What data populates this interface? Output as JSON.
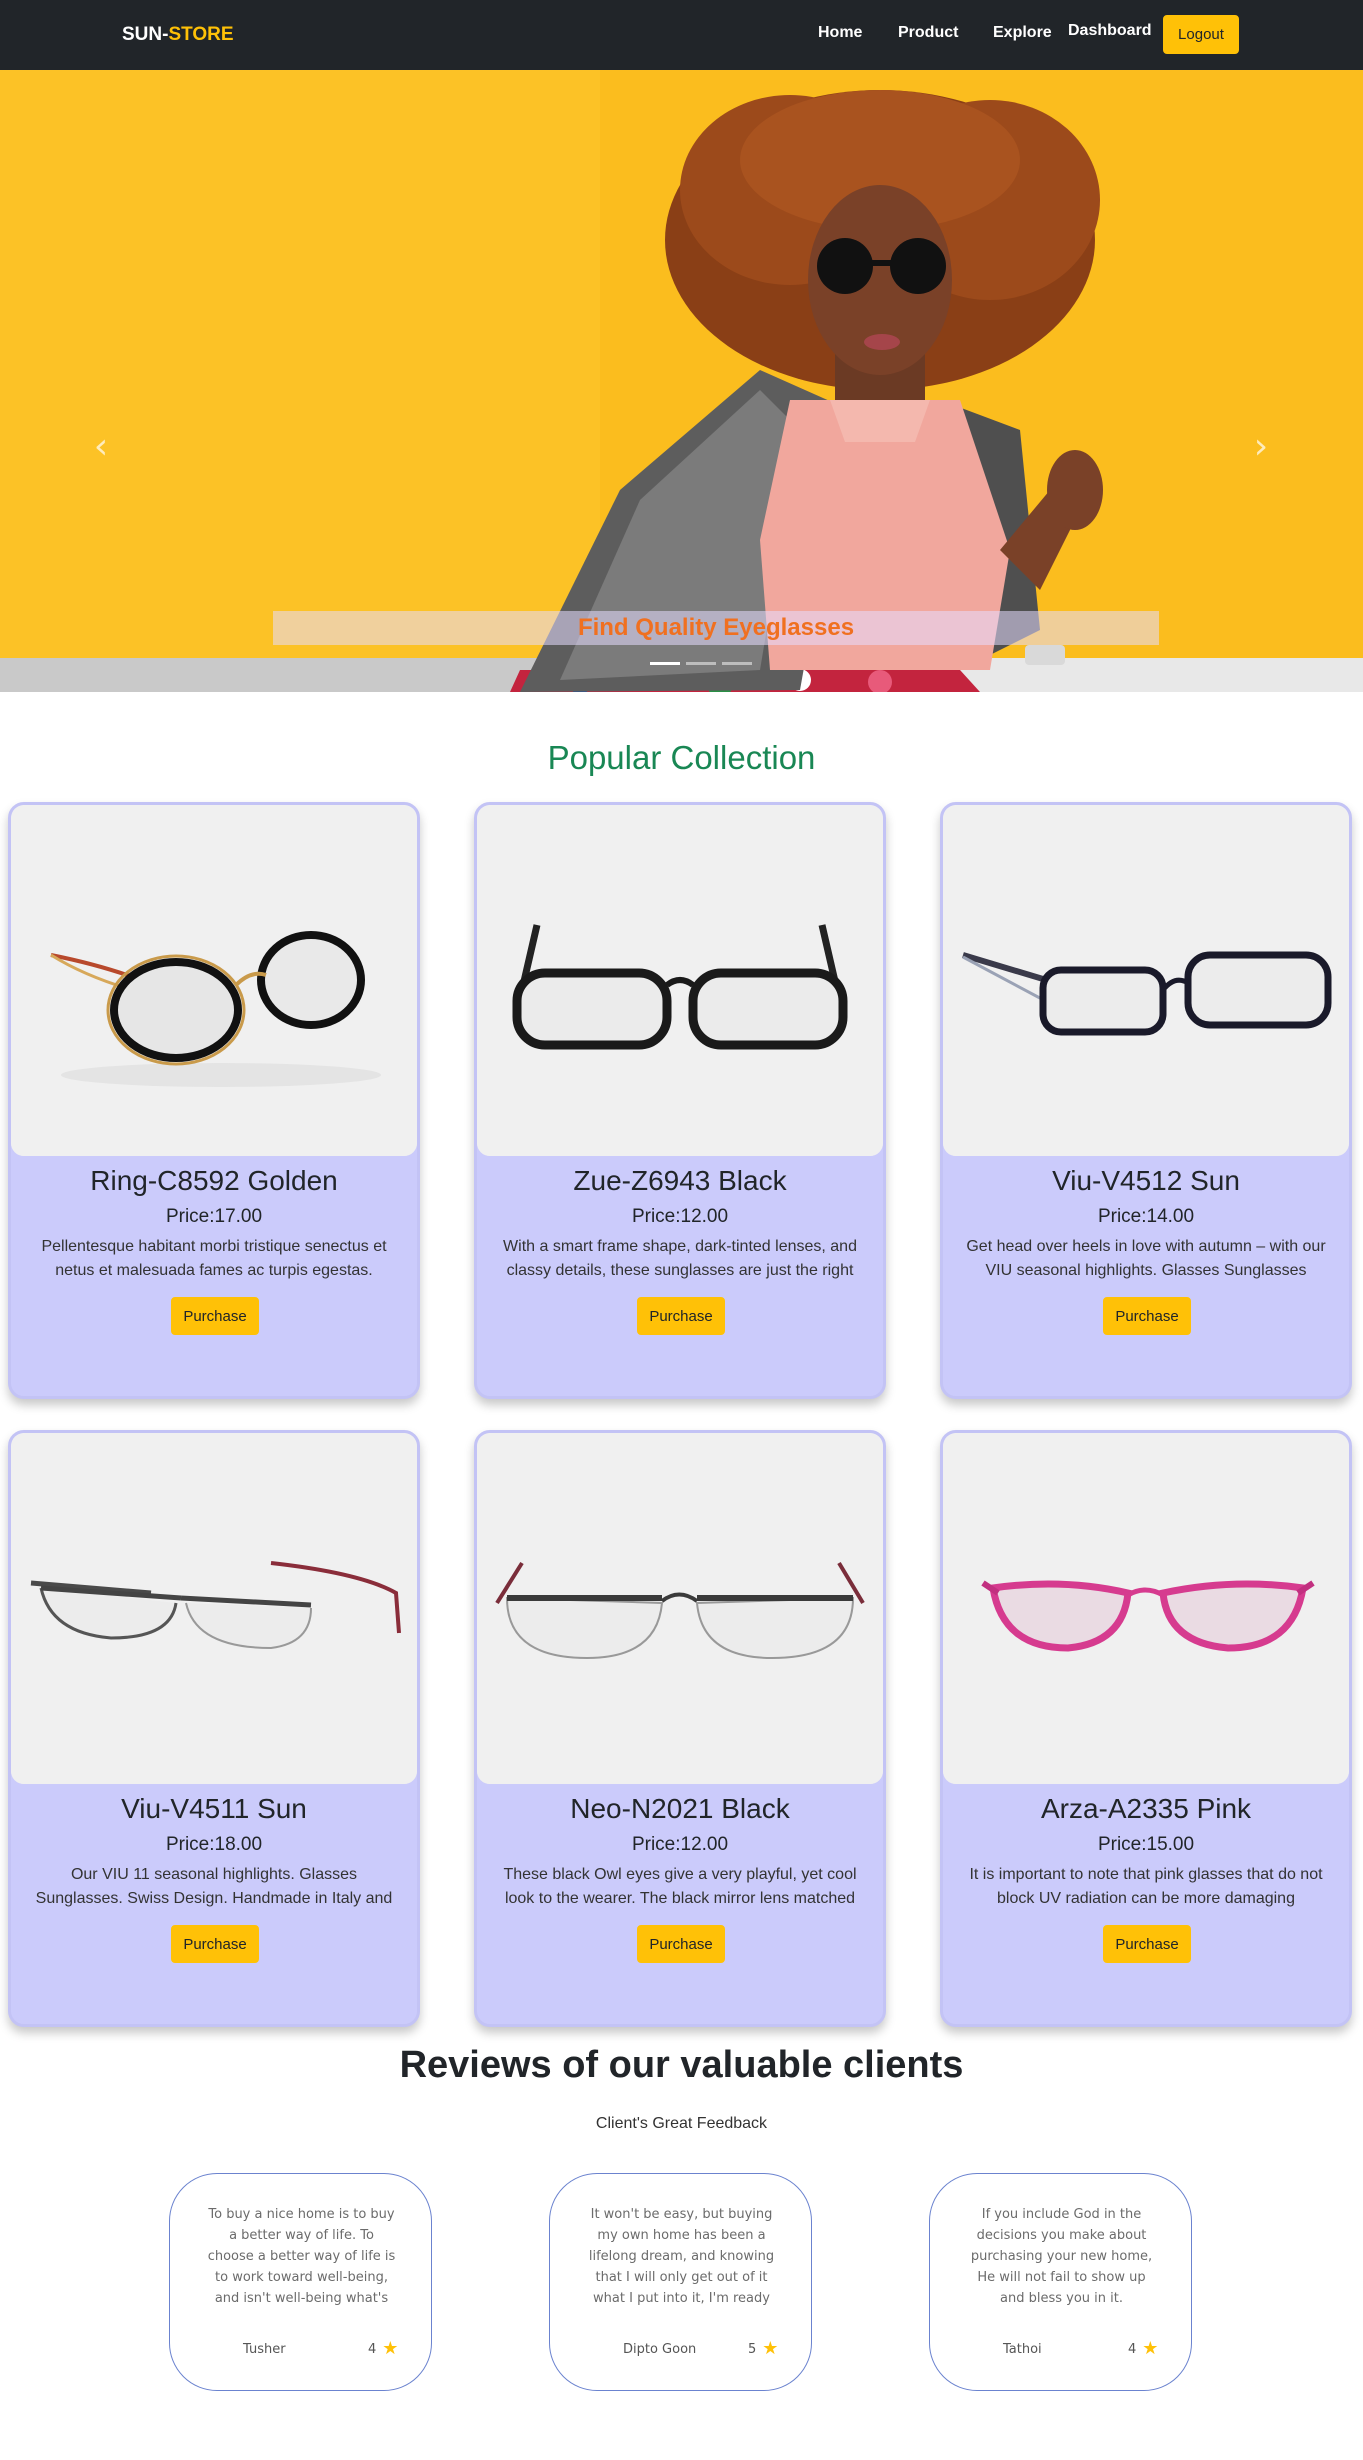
{
  "navbar": {
    "brand_prefix": "SUN-",
    "brand_suffix": "STORE",
    "links": [
      "Home",
      "Product",
      "Explore",
      "Dashboard"
    ],
    "logout_label": "Logout"
  },
  "hero": {
    "caption": "Find Quality Eyeglasses",
    "prev_icon": "chevron-left-icon",
    "next_icon": "chevron-right-icon",
    "slide_count": 3,
    "active_slide": 1
  },
  "collection": {
    "title": "Popular Collection",
    "products": [
      {
        "name": "Ring-C8592 Golden",
        "price": "Price:17.00",
        "description": "Pellentesque habitant morbi tristique senectus et netus et malesuada fames ac turpis egestas.",
        "button": "Purchase"
      },
      {
        "name": "Zue-Z6943 Black",
        "price": "Price:12.00",
        "description": "With a smart frame shape, dark-tinted lenses, and classy details, these sunglasses are just the right",
        "button": "Purchase"
      },
      {
        "name": "Viu-V4512 Sun",
        "price": "Price:14.00",
        "description": "Get head over heels in love with autumn – with our VIU seasonal highlights. Glasses Sunglasses",
        "button": "Purchase"
      },
      {
        "name": "Viu-V4511 Sun",
        "price": "Price:18.00",
        "description": "Our VIU 11 seasonal highlights. Glasses Sunglasses. Swiss Design. Handmade in Italy and Japan",
        "button": "Purchase"
      },
      {
        "name": "Neo-N2021 Black",
        "price": "Price:12.00",
        "description": "These black Owl eyes give a very playful, yet cool look to the wearer. The black mirror lens matched",
        "button": "Purchase"
      },
      {
        "name": "Arza-A2335 Pink",
        "price": "Price:15.00",
        "description": "It is important to note that pink glasses that do not block UV radiation can be more damaging",
        "button": "Purchase"
      }
    ]
  },
  "reviews": {
    "title": "Reviews of our valuable clients",
    "subtitle": "Client's Great Feedback",
    "items": [
      {
        "text": "To buy a nice home is to buy a better way of life. To choose a better way of life is to work toward well-being, and isn't well-being what's paramount",
        "name": "Tusher",
        "rating": "4"
      },
      {
        "text": "It won't be easy, but buying my own home has been a lifelong dream, and knowing that I will only get out of it what I put into it, I'm ready to get a",
        "name": "Dipto Goon",
        "rating": "5"
      },
      {
        "text": "If you include God in the decisions you make about purchasing your new home, He will not fail to show up and bless you in it.",
        "name": "Tathoi",
        "rating": "4"
      }
    ]
  },
  "colors": {
    "navbar_bg": "#212529",
    "accent": "#ffc107",
    "card_bg": "#cbcbfb",
    "section_title": "#198754",
    "caption": "#f07020"
  }
}
